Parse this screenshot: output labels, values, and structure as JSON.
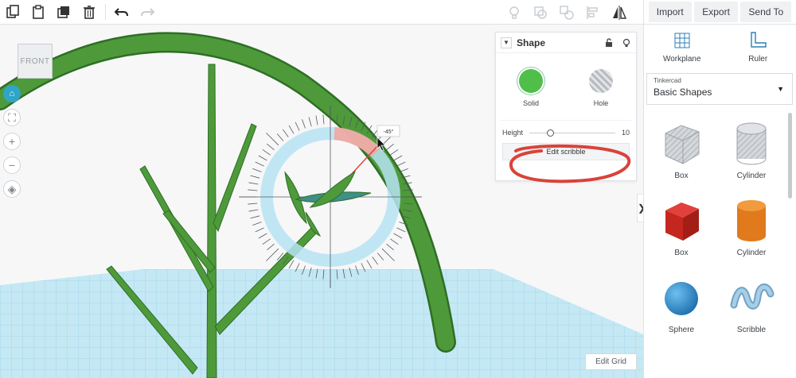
{
  "toolbar": {
    "left_icons": [
      "copy-icon",
      "paste-icon",
      "duplicate-icon",
      "trash-icon",
      "undo-icon",
      "redo-icon"
    ],
    "right_icons": [
      "light-icon",
      "group-icon",
      "ungroup-icon",
      "align-icon",
      "mirror-icon"
    ]
  },
  "actions": {
    "import": "Import",
    "export": "Export",
    "send_to": "Send To"
  },
  "viewport": {
    "view_cube_label": "FRONT",
    "rotation_label": "-45°",
    "edit_grid_label": "Edit Grid",
    "solid_color": "#4e9a3a",
    "grid_color": "#a9dcee"
  },
  "inspector": {
    "title": "Shape",
    "solid_label": "Solid",
    "hole_label": "Hole",
    "height_label": "Height",
    "height_value": "10",
    "edit_scribble_label": "Edit scribble",
    "highlight_color": "#d9433a"
  },
  "panel": {
    "workplane_label": "Workplane",
    "ruler_label": "Ruler",
    "library_small": "Tinkercad",
    "library_main": "Basic Shapes",
    "shapes": [
      {
        "label": "Box",
        "icon": "box-hole-icon"
      },
      {
        "label": "Cylinder",
        "icon": "cylinder-hole-icon"
      },
      {
        "label": "Box",
        "icon": "box-icon"
      },
      {
        "label": "Cylinder",
        "icon": "cylinder-icon"
      },
      {
        "label": "Sphere",
        "icon": "sphere-icon"
      },
      {
        "label": "Scribble",
        "icon": "scribble-icon"
      }
    ]
  }
}
